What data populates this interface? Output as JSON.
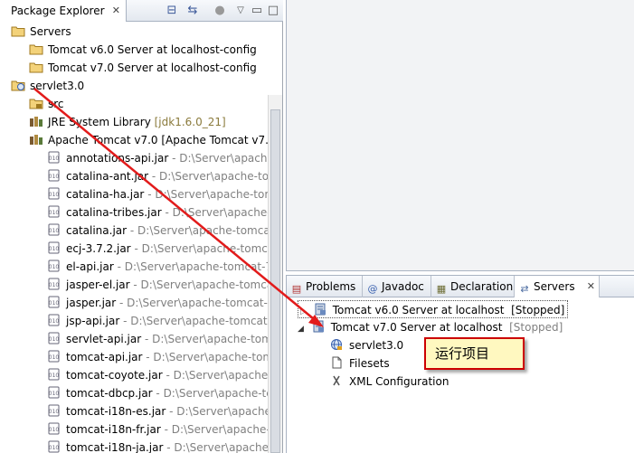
{
  "package_explorer": {
    "tab_title": "Package Explorer",
    "toolbar_icons": [
      "collapse-all-icon",
      "link-with-editor-icon",
      "filter-icon",
      "view-menu-icon",
      "minimize-icon",
      "maximize-icon"
    ],
    "tree": [
      {
        "label": "Servers",
        "icon": "folder-icon",
        "indent": 0
      },
      {
        "label": "Tomcat v6.0 Server at localhost-config",
        "icon": "folder-icon",
        "indent": 1
      },
      {
        "label": "Tomcat v7.0 Server at localhost-config",
        "icon": "folder-icon",
        "indent": 1
      },
      {
        "label": "servlet3.0",
        "icon": "web-project-icon",
        "indent": 0
      },
      {
        "label": "src",
        "icon": "source-folder-icon",
        "indent": 1
      },
      {
        "label": "JRE System Library",
        "suffix": " [jdk1.6.0_21]",
        "icon": "library-icon",
        "indent": 1
      },
      {
        "label": "Apache Tomcat v7.0 [Apache Tomcat v7.0",
        "icon": "library-icon",
        "indent": 1
      },
      {
        "label": "annotations-api.jar",
        "suffix": " - D:\\Server\\apache",
        "icon": "jar-icon",
        "indent": 2
      },
      {
        "label": "catalina-ant.jar",
        "suffix": " - D:\\Server\\apache-tom",
        "icon": "jar-icon",
        "indent": 2
      },
      {
        "label": "catalina-ha.jar",
        "suffix": " - D:\\Server\\apache-tom",
        "icon": "jar-icon",
        "indent": 2
      },
      {
        "label": "catalina-tribes.jar",
        "suffix": " - D:\\Server\\apache-t",
        "icon": "jar-icon",
        "indent": 2
      },
      {
        "label": "catalina.jar",
        "suffix": " - D:\\Server\\apache-tomcat",
        "icon": "jar-icon",
        "indent": 2
      },
      {
        "label": "ecj-3.7.2.jar",
        "suffix": " - D:\\Server\\apache-tomcat",
        "icon": "jar-icon",
        "indent": 2
      },
      {
        "label": "el-api.jar",
        "suffix": " - D:\\Server\\apache-tomcat-7",
        "icon": "jar-icon",
        "indent": 2
      },
      {
        "label": "jasper-el.jar",
        "suffix": " - D:\\Server\\apache-tomca",
        "icon": "jar-icon",
        "indent": 2
      },
      {
        "label": "jasper.jar",
        "suffix": " - D:\\Server\\apache-tomcat-7",
        "icon": "jar-icon",
        "indent": 2
      },
      {
        "label": "jsp-api.jar",
        "suffix": " - D:\\Server\\apache-tomcat-",
        "icon": "jar-icon",
        "indent": 2
      },
      {
        "label": "servlet-api.jar",
        "suffix": " - D:\\Server\\apache-tom",
        "icon": "jar-icon",
        "indent": 2
      },
      {
        "label": "tomcat-api.jar",
        "suffix": " - D:\\Server\\apache-tom",
        "icon": "jar-icon",
        "indent": 2
      },
      {
        "label": "tomcat-coyote.jar",
        "suffix": " - D:\\Server\\apache-",
        "icon": "jar-icon",
        "indent": 2
      },
      {
        "label": "tomcat-dbcp.jar",
        "suffix": " - D:\\Server\\apache-tc",
        "icon": "jar-icon",
        "indent": 2
      },
      {
        "label": "tomcat-i18n-es.jar",
        "suffix": " - D:\\Server\\apache-",
        "icon": "jar-icon",
        "indent": 2
      },
      {
        "label": "tomcat-i18n-fr.jar",
        "suffix": " - D:\\Server\\apache-t",
        "icon": "jar-icon",
        "indent": 2
      },
      {
        "label": "tomcat-i18n-ja.jar",
        "suffix": " - D:\\Server\\apache-",
        "icon": "jar-icon",
        "indent": 2
      }
    ]
  },
  "bottom_views": {
    "tabs": [
      {
        "label": "Problems",
        "icon": "problems-icon"
      },
      {
        "label": "Javadoc",
        "icon": "javadoc-icon"
      },
      {
        "label": "Declaration",
        "icon": "declaration-icon"
      },
      {
        "label": "Servers",
        "icon": "servers-icon",
        "active": true
      }
    ],
    "servers": [
      {
        "label": "Tomcat v6.0 Server at localhost",
        "status": "[Stopped]",
        "selected": true,
        "expanded": false
      },
      {
        "label": "Tomcat v7.0 Server at localhost",
        "status": "[Stopped]",
        "selected": false,
        "expanded": true,
        "children": [
          {
            "label": "servlet3.0",
            "icon": "web-module-icon"
          },
          {
            "label": "Filesets",
            "icon": "filesets-icon"
          },
          {
            "label": "XML Configuration",
            "icon": "xml-config-icon"
          }
        ]
      }
    ]
  },
  "callout": {
    "text": "运行项目"
  },
  "colors": {
    "arrow": "#e21b1b",
    "callout_border": "#cc0000",
    "callout_fill": "#fff8c0",
    "selection": "#ffffff"
  }
}
